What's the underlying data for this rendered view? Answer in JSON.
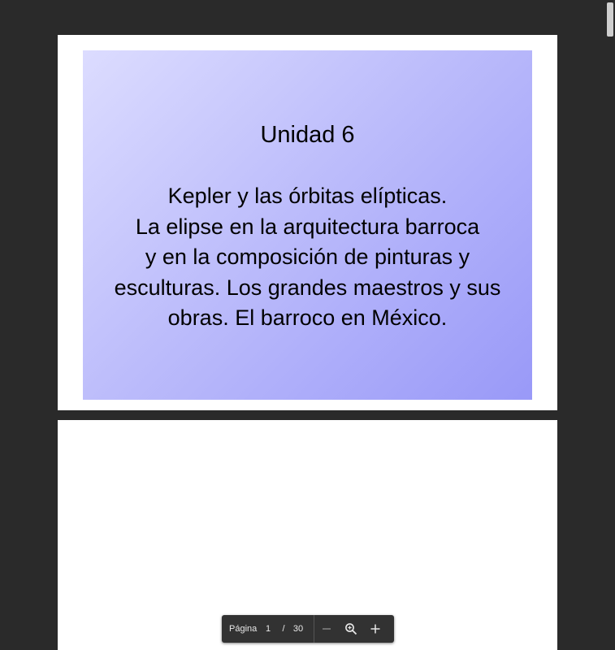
{
  "slide": {
    "title": "Unidad 6",
    "body_lines": [
      "Kepler y las órbitas elípticas.",
      "La elipse en la arquitectura barroca",
      "y en la composición de pinturas y",
      "esculturas. Los grandes maestros y sus",
      "obras. El barroco en México."
    ]
  },
  "toolbar": {
    "page_label": "Página",
    "current_page": "1",
    "separator": "/",
    "total_pages": "30",
    "zoom_out_icon": "minus-icon",
    "zoom_icon": "magnifier-icon",
    "zoom_in_icon": "plus-icon"
  },
  "colors": {
    "background": "#2a2a2a",
    "toolbar": "#323232",
    "slide_gradient_start": "#dcdcff",
    "slide_gradient_end": "#9999f8"
  }
}
